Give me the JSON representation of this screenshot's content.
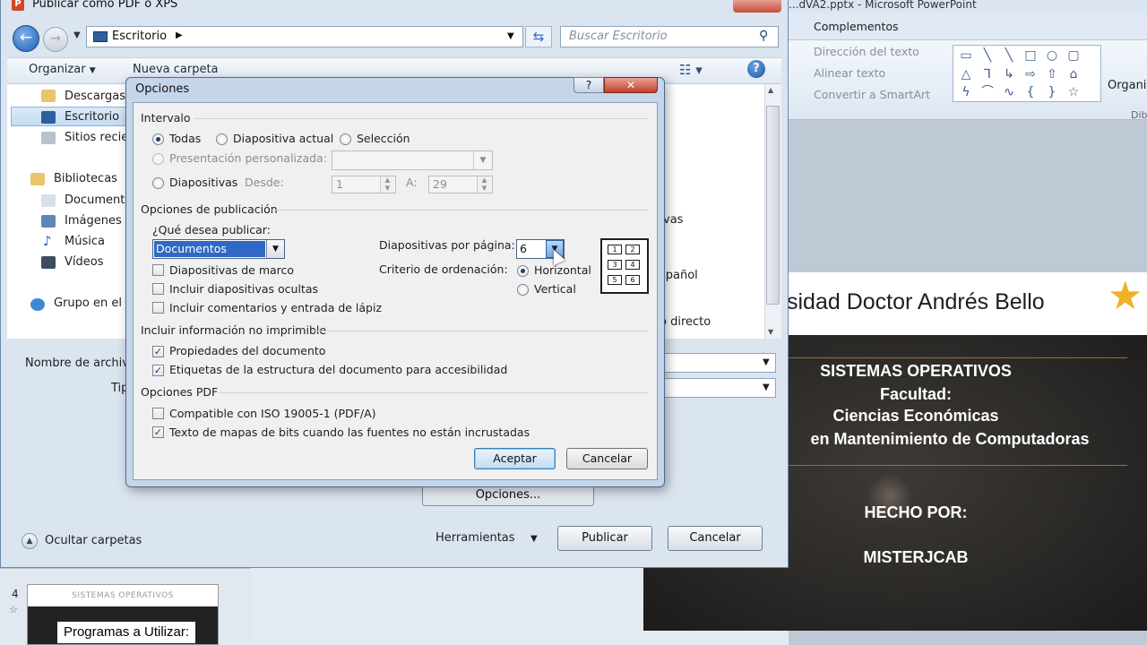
{
  "powerpoint": {
    "title": "...dVA2.pptx - Microsoft PowerPoint",
    "tab_complementos": "Complementos",
    "ribbon": {
      "direccion_texto": "Dirección del texto",
      "alinear_texto": "Alinear texto",
      "convertir_smartart": "Convertir a SmartArt",
      "organizar": "Organi",
      "dib": "Dib"
    },
    "slide": {
      "header": "sidad Doctor Andrés Bello",
      "line1": "SISTEMAS OPERATIVOS",
      "line2": "Facultad:",
      "line3": "Ciencias Económicas",
      "line4": "en Mantenimiento de Computadoras",
      "line5": "HECHO POR:",
      "line6": "MISTERJCAB"
    },
    "thumbnail": {
      "number": "4",
      "header": "SISTEMAS OPERATIVOS",
      "content": "Programas a Utilizar:"
    }
  },
  "publish_dialog": {
    "title": "Publicar como PDF o XPS",
    "address": "Escritorio",
    "search_placeholder": "Buscar Escritorio",
    "toolbar": {
      "organizar": "Organizar",
      "nueva_carpeta": "Nueva carpeta"
    },
    "nav_items": [
      {
        "label": "Descargas",
        "icon": "folder-down-icon"
      },
      {
        "label": "Escritorio",
        "icon": "desktop-icon"
      },
      {
        "label": "Sitios recie",
        "icon": "recent-places-icon"
      },
      {
        "label": "Bibliotecas",
        "icon": "library-icon"
      },
      {
        "label": "Document",
        "icon": "documents-icon"
      },
      {
        "label": "Imágenes",
        "icon": "images-icon"
      },
      {
        "label": "Música",
        "icon": "music-icon"
      },
      {
        "label": "Vídeos",
        "icon": "videos-icon"
      },
      {
        "label": "Grupo en el h",
        "icon": "homegroup-icon"
      }
    ],
    "file_fragments": {
      "f1": "vas",
      "f2": "spañol",
      "f3": "o directo"
    },
    "nombre_label": "Nombre de archivo:",
    "tipo_label": "Tipo:",
    "opciones_button": "Opciones...",
    "ocultar_carpetas": "Ocultar carpetas",
    "herramientas": "Herramientas",
    "publicar": "Publicar",
    "cancelar": "Cancelar"
  },
  "options_dialog": {
    "title": "Opciones",
    "help_glyph": "?",
    "close_glyph": "✕",
    "intervalo": {
      "title": "Intervalo",
      "todas": "Todas",
      "diapositiva_actual": "Diapositiva actual",
      "seleccion": "Selección",
      "presentacion_personalizada": "Presentación personalizada:",
      "diapositivas": "Diapositivas",
      "desde": "Desde:",
      "desde_value": "1",
      "a": "A:",
      "a_value": "29",
      "selected": "todas"
    },
    "publicacion": {
      "title": "Opciones de publicación",
      "que_desea": "¿Qué desea publicar:",
      "que_desea_value": "Documentos",
      "diapositivas_por_pagina": "Diapositivas por página:",
      "diapositivas_por_pagina_value": "6",
      "criterio": "Criterio de ordenación:",
      "horizontal": "Horizontal",
      "vertical": "Vertical",
      "orden_selected": "horizontal",
      "marco": "Diapositivas de marco",
      "ocultas": "Incluir diapositivas ocultas",
      "comentarios": "Incluir comentarios y entrada de lápiz",
      "marco_checked": false,
      "ocultas_checked": false,
      "comentarios_checked": false,
      "layout_cells": [
        "1",
        "2",
        "3",
        "4",
        "5",
        "6"
      ]
    },
    "no_imprimible": {
      "title": "Incluir información no imprimible",
      "propiedades": "Propiedades del documento",
      "etiquetas": "Etiquetas de la estructura del documento para accesibilidad",
      "propiedades_checked": true,
      "etiquetas_checked": true
    },
    "pdf": {
      "title": "Opciones PDF",
      "iso": "Compatible con ISO 19005-1 (PDF/A)",
      "mapas": "Texto de mapas de bits cuando las fuentes no están incrustadas",
      "iso_checked": false,
      "mapas_checked": true
    },
    "aceptar": "Aceptar",
    "cancelar": "Cancelar"
  },
  "colors": {
    "accent": "#3069c5",
    "slide_star": "#f0b028",
    "close_red": "#c3412c"
  }
}
